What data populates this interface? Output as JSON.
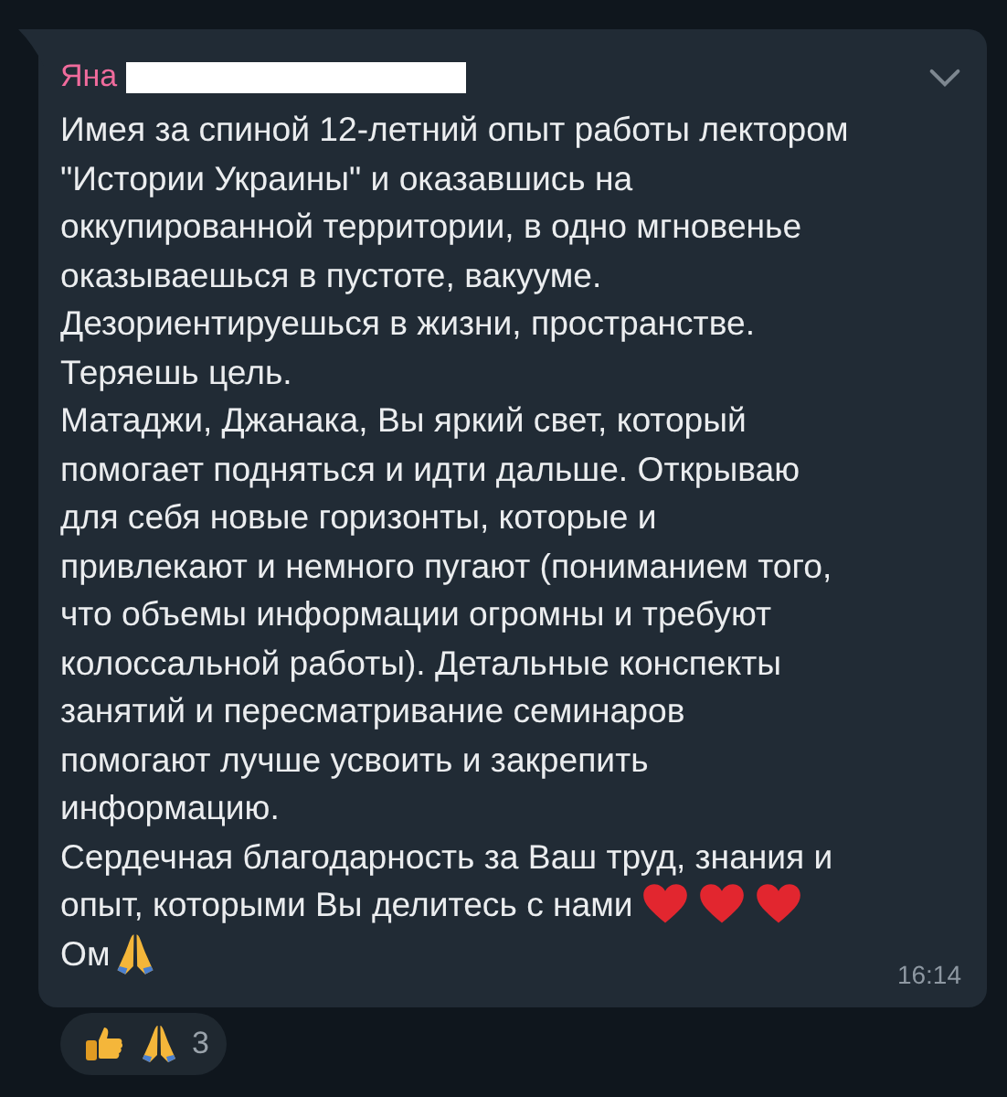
{
  "message": {
    "sender": "Яна",
    "time": "16:14",
    "lines": [
      {
        "text": "Имея за спиной 12-летний опыт работы лектором"
      },
      {
        "text": "\"Истории Украины\" и оказавшись на"
      },
      {
        "text": "оккупированной территории, в одно мгновенье"
      },
      {
        "text": "оказываешься в пустоте, вакууме."
      },
      {
        "text": "Дезориентируешься в жизни, пространстве."
      },
      {
        "text": "Теряешь цель."
      },
      {
        "text": "Матаджи, Джанака, Вы яркий свет, который"
      },
      {
        "text": "помогает подняться и идти дальше. Открываю"
      },
      {
        "text": "для себя новые горизонты, которые и"
      },
      {
        "text": "привлекают и немного пугают (пониманием того,"
      },
      {
        "text": "что объемы информации огромны и требуют"
      },
      {
        "text": "колоссальной работы). Детальные конспекты"
      },
      {
        "text": "занятий и пересматривание семинаров"
      },
      {
        "text": "помогают лучше усвоить и закрепить"
      },
      {
        "text": "информацию."
      },
      {
        "text": "Сердечная благодарность за Ваш труд, знания и"
      },
      {
        "text": "опыт, которыми Вы делитесь с нами",
        "icons": [
          {
            "kind": "heart"
          },
          {
            "kind": "heart"
          },
          {
            "kind": "heart"
          }
        ]
      },
      {
        "text": "Ом",
        "icons": [
          {
            "kind": "pray"
          }
        ]
      }
    ],
    "reactions": {
      "icons": [
        {
          "kind": "thumbs-up"
        },
        {
          "kind": "pray"
        }
      ],
      "count": "3"
    }
  }
}
